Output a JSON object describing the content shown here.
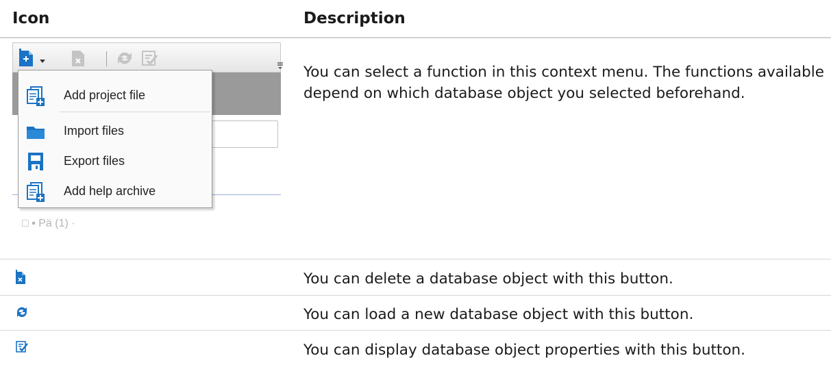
{
  "table": {
    "headers": {
      "icon": "Icon",
      "description": "Description"
    },
    "rows": [
      {
        "icon": "context-menu-screenshot",
        "description": "You can select a function in this context menu. The functions available depend on which database object you selected beforehand."
      },
      {
        "icon": "delete-object-icon",
        "description": "You can delete a database object with this button."
      },
      {
        "icon": "reload-icon",
        "description": "You can load a new database object with this button."
      },
      {
        "icon": "properties-icon",
        "description": "You can display database object properties with this button."
      }
    ]
  },
  "context_menu": {
    "items": [
      {
        "label": "Add project file",
        "icon": "add-file-icon"
      },
      {
        "label": "Import files",
        "icon": "folder-icon"
      },
      {
        "label": "Export files",
        "icon": "save-icon"
      },
      {
        "label": "Add help archive",
        "icon": "add-file-icon"
      }
    ]
  },
  "colors": {
    "icon_blue": "#1a73c4",
    "header_rule": "#d0d0d0"
  }
}
